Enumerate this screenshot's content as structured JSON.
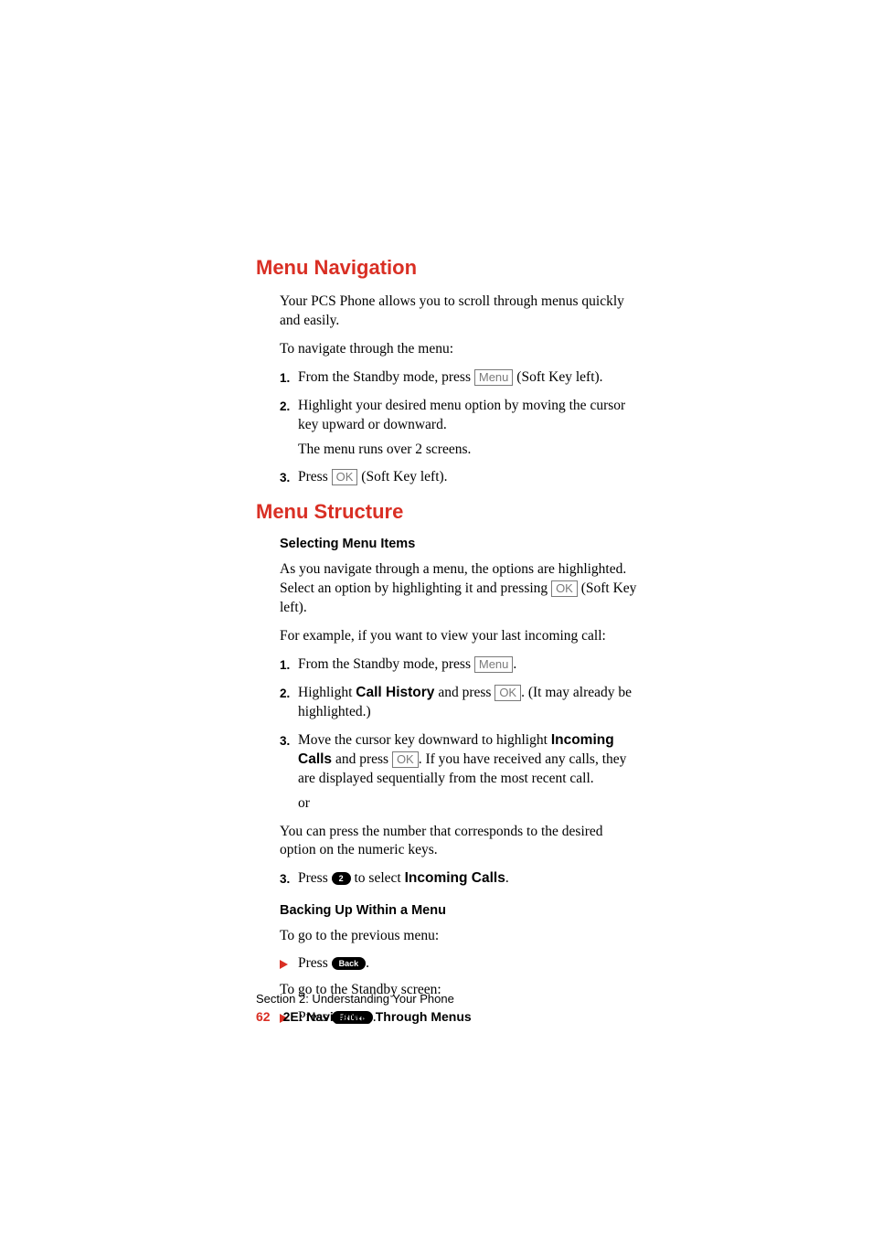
{
  "headings": {
    "menu_navigation": "Menu Navigation",
    "menu_structure": "Menu Structure"
  },
  "subheadings": {
    "selecting_menu_items": "Selecting Menu Items",
    "backing_up": "Backing Up Within a Menu"
  },
  "nav": {
    "intro": "Your PCS Phone allows you to scroll through menus quickly and easily.",
    "to_navigate": "To navigate through the menu:",
    "step1_a": "From the Standby mode, press ",
    "step1_key": "Menu",
    "step1_b": " (Soft Key left).",
    "step2": "Highlight your desired menu option by moving the cursor key upward or downward.",
    "step2_sub": "The menu runs over 2 screens.",
    "step3_a": "Press ",
    "step3_key": "OK",
    "step3_b": " (Soft Key left)."
  },
  "structure": {
    "intro_a": "As you navigate through a menu, the options are highlighted. Select an option by highlighting it and pressing ",
    "intro_key": "OK",
    "intro_b": " (Soft Key left).",
    "example_lead": "For example, if you want to view your last incoming call:",
    "s1_a": "From the Standby mode, press ",
    "s1_key": "Menu",
    "s1_b": ".",
    "s2_a": "Highlight ",
    "s2_bold": "Call History",
    "s2_b": " and press ",
    "s2_key": "OK",
    "s2_c": ". (It may already be highlighted.)",
    "s3_a": "Move the cursor key downward to highlight ",
    "s3_bold": "Incoming Calls",
    "s3_b": " and press ",
    "s3_key": "OK",
    "s3_c": ". If you have received any calls, they are displayed sequentially from the most recent call.",
    "or": "or",
    "alt_para": "You can press the number that corresponds to the desired option on the numeric keys.",
    "alt3_a": "Press ",
    "alt3_pill": "2",
    "alt3_b": " to select ",
    "alt3_bold": "Incoming Calls",
    "alt3_c": "."
  },
  "backing": {
    "prev_lead": "To go to the previous menu:",
    "prev_press": "Press ",
    "prev_pill": "Back",
    "prev_dot": ".",
    "standby_lead": "To go to the Standby screen:",
    "standby_press": "Press ",
    "standby_pill": "END/Ⓘ",
    "standby_pill_display": "END/⊘",
    "standby_dot": "."
  },
  "footer": {
    "section": "Section 2: Understanding Your Phone",
    "page_num": "62",
    "page_title": "2E: Navigating Through Menus"
  },
  "step_labels": {
    "n1": "1.",
    "n2": "2.",
    "n3": "3."
  }
}
